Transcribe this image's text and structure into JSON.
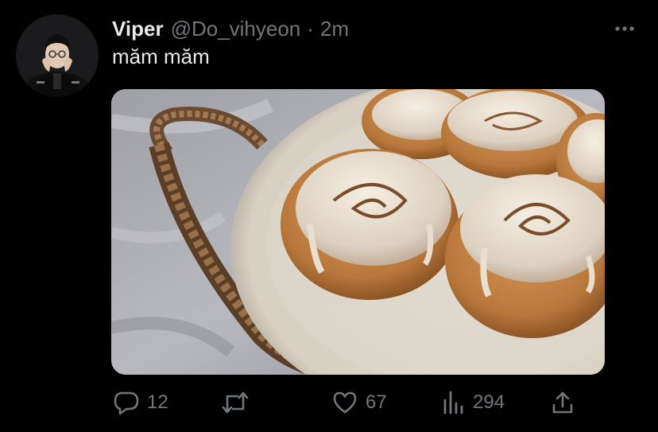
{
  "tweet": {
    "display_name": "Viper",
    "handle": "@Do_vihyeon",
    "separator": "·",
    "time": "2m",
    "text": "măm măm",
    "avatar_icon": "user-avatar",
    "more_icon": "more-horizontal-icon",
    "media_description_icon": "cinnamon-rolls-photo"
  },
  "actions": {
    "reply": {
      "icon": "reply-icon",
      "count": "12"
    },
    "retweet": {
      "icon": "retweet-icon",
      "count": ""
    },
    "like": {
      "icon": "heart-icon",
      "count": "67"
    },
    "views": {
      "icon": "views-icon",
      "count": "294"
    },
    "share": {
      "icon": "share-icon",
      "count": ""
    }
  },
  "colors": {
    "background": "#000000",
    "primary_text": "#e7e9ea",
    "secondary_text": "#71767b"
  }
}
